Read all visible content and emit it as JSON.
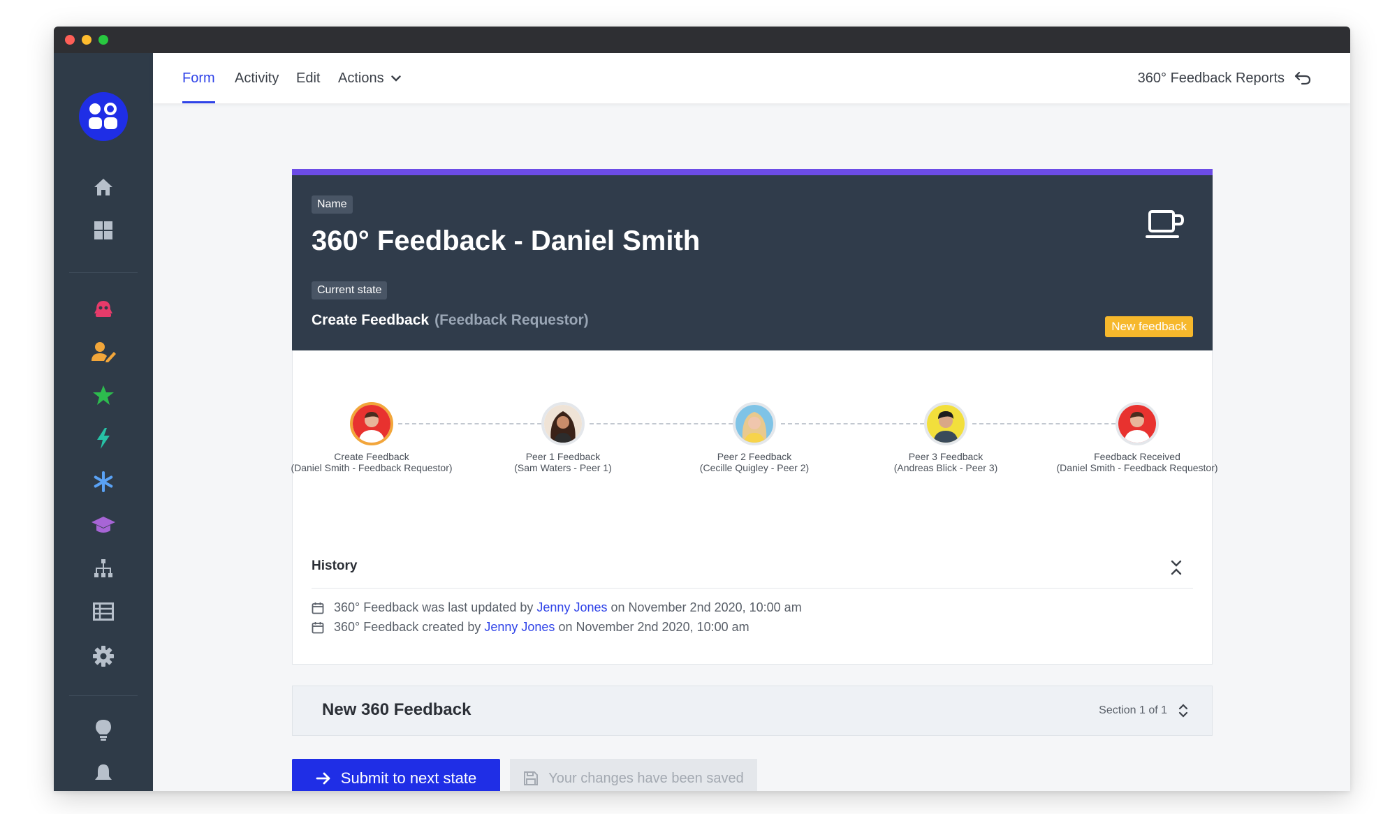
{
  "topnav": {
    "tabs": [
      {
        "label": "Form",
        "active": true
      },
      {
        "label": "Activity",
        "active": false
      },
      {
        "label": "Edit",
        "active": false
      },
      {
        "label": "Actions",
        "active": false
      }
    ],
    "reports_link": "360° Feedback Reports"
  },
  "sidebar": {
    "icons": [
      "home-icon",
      "grid-icon",
      "bug-icon",
      "user-edit-icon",
      "star-icon",
      "bolt-icon",
      "asterisk-icon",
      "graduation-cap-icon",
      "org-chart-icon",
      "table-icon",
      "gear-icon",
      "lightbulb-icon",
      "bell-icon"
    ]
  },
  "header": {
    "name_chip": "Name",
    "title": "360° Feedback - Daniel Smith",
    "state_chip": "Current state",
    "state_name": "Create Feedback",
    "state_role": "(Feedback Requestor)",
    "badge": "New feedback"
  },
  "workflow": {
    "steps": [
      {
        "line1": "Create Feedback",
        "line2": "(Daniel Smith - Feedback Requestor)",
        "current": true
      },
      {
        "line1": "Peer 1 Feedback",
        "line2": "(Sam Waters - Peer 1)",
        "current": false
      },
      {
        "line1": "Peer 2 Feedback",
        "line2": "(Cecille Quigley - Peer 2)",
        "current": false
      },
      {
        "line1": "Peer 3 Feedback",
        "line2": "(Andreas Blick - Peer 3)",
        "current": false
      },
      {
        "line1": "Feedback Received",
        "line2": "(Daniel Smith - Feedback Requestor)",
        "current": false
      }
    ]
  },
  "history": {
    "title": "History",
    "items": [
      {
        "prefix": "360° Feedback was last updated by",
        "user": "Jenny Jones",
        "suffix": "on November 2nd 2020, 10:00 am"
      },
      {
        "prefix": "360° Feedback created by",
        "user": "Jenny Jones",
        "suffix": "on November 2nd 2020, 10:00 am"
      }
    ]
  },
  "section": {
    "title": "New 360 Feedback",
    "count": "Section 1 of 1"
  },
  "footer": {
    "submit_label": "Submit to next state",
    "saved_label": "Your changes have been saved"
  },
  "colors": {
    "accent": "#2f43e8",
    "header_bg": "#303c4b",
    "header_stripe": "#6c4ce6",
    "badge": "#f6b82c",
    "sidebar_bg": "#2f3b48"
  }
}
